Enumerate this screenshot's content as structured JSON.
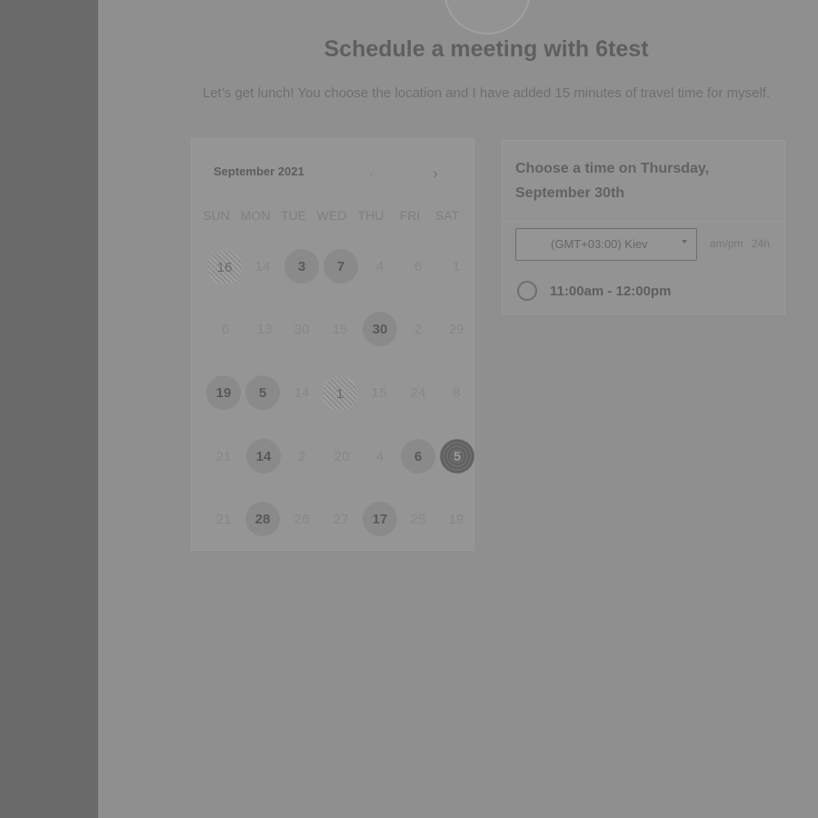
{
  "header": {
    "title": "Schedule a meeting with 6test",
    "subtitle": "Let’s get lunch! You choose the location and I have added 15 minutes of travel time for myself."
  },
  "calendar": {
    "month_label": "September 2021",
    "prev_icon": "‹",
    "next_icon": "›",
    "weekdays": [
      "SUN",
      "MON",
      "TUE",
      "WED",
      "THU",
      "FRI",
      "SAT"
    ],
    "rows": [
      [
        "16",
        "14",
        "3",
        "7",
        "4",
        "6",
        "1"
      ],
      [
        "6",
        "13",
        "30",
        "15",
        "30",
        "2",
        "29"
      ],
      [
        "19",
        "5",
        "14",
        "1",
        "15",
        "24",
        "8"
      ],
      [
        "21",
        "14",
        "2",
        "20",
        "4",
        "6",
        "5"
      ],
      [
        "21",
        "28",
        "26",
        "27",
        "17",
        "25",
        "19"
      ]
    ]
  },
  "times": {
    "heading": "Choose a time on Thursday, September 30th",
    "timezone": "(GMT+03:00) Kiev",
    "format_ampm": "am/pm",
    "format_24h": "24h",
    "slot_label": "11:00am - 12:00pm"
  }
}
